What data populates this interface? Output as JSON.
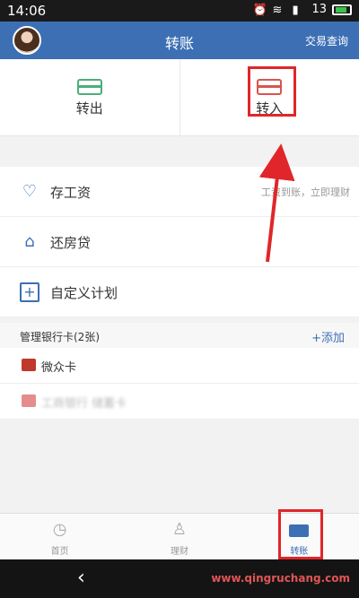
{
  "status_bar": {
    "time": "14:06",
    "signal_text": "13"
  },
  "header": {
    "title": "转账",
    "query_label": "交易查询"
  },
  "tabs": {
    "out_label": "转出",
    "in_label": "转入"
  },
  "plans": [
    {
      "label": "存工资",
      "icon": "piggy-bank-icon",
      "hint": "工资到账，立即理财"
    },
    {
      "label": "还房贷",
      "icon": "house-icon",
      "hint": ""
    },
    {
      "label": "自定义计划",
      "icon": "plus-box-icon",
      "hint": ""
    }
  ],
  "cards_section": {
    "title": "管理银行卡(2张)",
    "add_label": "+添加"
  },
  "cards": [
    {
      "label": "微众卡",
      "color": "#c0392b",
      "blurred": false
    },
    {
      "label": "工商银行 储蓄卡",
      "color": "#e58c8c",
      "blurred": true
    }
  ],
  "bottom_nav": [
    {
      "label": "首页",
      "icon": "clock-icon",
      "active": false
    },
    {
      "label": "理财",
      "icon": "money-bag-icon",
      "active": false
    },
    {
      "label": "转账",
      "icon": "card-icon",
      "active": true
    }
  ],
  "system_nav": {
    "watermark": "www.qingruchang.com"
  },
  "colors": {
    "brand": "#3d6fb4",
    "highlight": "#e0262a"
  }
}
